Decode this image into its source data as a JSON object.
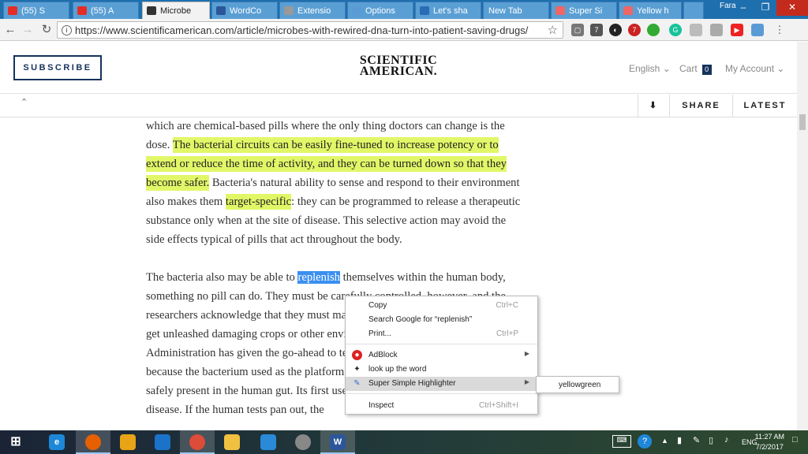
{
  "browser": {
    "tabs": [
      {
        "title": "(55) S",
        "icon": "youtube-icon",
        "color": "#e52d27"
      },
      {
        "title": "(55) A",
        "icon": "youtube-icon",
        "color": "#e52d27"
      },
      {
        "title": "Microbe",
        "icon": "sciam-icon",
        "color": "#333333"
      },
      {
        "title": "WordCo",
        "icon": "word-icon",
        "color": "#2b579a"
      },
      {
        "title": "Extensio",
        "icon": "puzzle-icon",
        "color": "#999999"
      },
      {
        "title": "Options",
        "icon": "pen-icon",
        "color": "#5b9bd5"
      },
      {
        "title": "Let's sha",
        "icon": "site-icon",
        "color": "#2a6db5"
      },
      {
        "title": "New Tab",
        "icon": "",
        "color": ""
      },
      {
        "title": "Super Si",
        "icon": "store-icon",
        "color": "#e66"
      },
      {
        "title": "Yellow h",
        "icon": "store-icon",
        "color": "#e66"
      }
    ],
    "profile": "Fara",
    "url": "https://www.scientificamerican.com/article/microbes-with-rewired-dna-turn-into-patient-saving-drugs/",
    "extension_badges": [
      "7",
      "7"
    ]
  },
  "header": {
    "subscribe": "SUBSCRIBE",
    "logo_line1": "SCIENTIFIC",
    "logo_line2": "AMERICAN.",
    "language": "English",
    "cart": "Cart",
    "cart_count": "0",
    "account": "My Account"
  },
  "subnav": {
    "share": "SHARE",
    "latest": "LATEST"
  },
  "article": {
    "p1_a": "which are chemical-based pills where the only thing doctors can change is the dose. ",
    "p1_hl1": "The bacterial circuits can be easily fine-tuned to increase potency or to extend or reduce the time of activity, and they can be turned down so that they become safer.",
    "p1_b": " Bacteria's natural ability to sense and respond to their environment also makes them ",
    "p1_hl2": "target-specific",
    "p1_c": ": they can be programmed to release a therapeutic substance only when at the site of disease. This selective action may avoid the side effects typical of pills that act throughout the body.",
    "p2_a": "The bacteria also may be able to ",
    "p2_sel": "replenish",
    "p2_b": " themselves within the human body, something no pill can do. They must be carefully controlled, however, and the researchers acknowledge that they must make sure these enhanced bugs will not get unleashed damaging crops or other environmental harm. The Food and Drug Administration has given the go-ahead to test the therapy in people this year because the bacterium used as the platform for the UCD therapy has long been safely present in the human gut. Its first use would be to treat inflammatory bowel disease. If the human tests pan out, the"
  },
  "context_menu": {
    "copy": "Copy",
    "copy_shortcut": "Ctrl+C",
    "search": "Search Google for “replenish”",
    "print": "Print...",
    "print_shortcut": "Ctrl+P",
    "adblock": "AdBlock",
    "lookup": "look up the word",
    "highlighter": "Super Simple Highlighter",
    "inspect": "Inspect",
    "inspect_shortcut": "Ctrl+Shift+I",
    "submenu_item": "yellowgreen"
  },
  "taskbar": {
    "lang": "ENG",
    "time": "11:27 AM",
    "date": "7/2/2017"
  },
  "colors": {
    "highlight": "#e2f768",
    "selection": "#3b8ff0",
    "brand": "#16325c"
  }
}
